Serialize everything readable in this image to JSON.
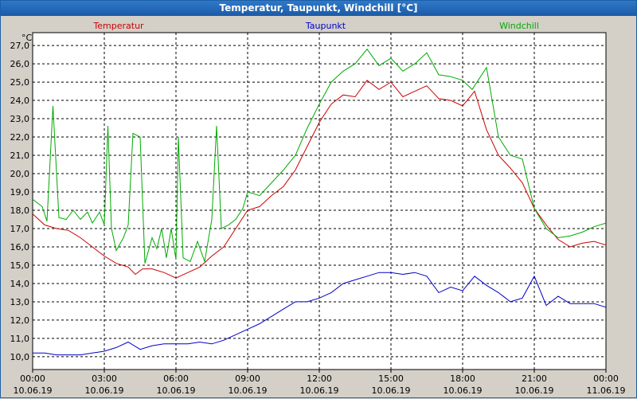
{
  "window": {
    "title": "Temperatur, Taupunkt, Windchill [°C]"
  },
  "chart_data": {
    "type": "line",
    "title": "Temperatur, Taupunkt, Windchill [°C]",
    "ylabel": "°C",
    "ylim": [
      9.3,
      27.7
    ],
    "yticks": [
      "10,0",
      "11,0",
      "12,0",
      "13,0",
      "14,0",
      "15,0",
      "16,0",
      "17,0",
      "18,0",
      "19,0",
      "20,0",
      "21,0",
      "22,0",
      "23,0",
      "24,0",
      "25,0",
      "26,0",
      "27,0"
    ],
    "xlim": [
      0,
      24
    ],
    "xticks": [
      {
        "time": "00:00",
        "date": "10.06.19"
      },
      {
        "time": "03:00",
        "date": "10.06.19"
      },
      {
        "time": "06:00",
        "date": "10.06.19"
      },
      {
        "time": "09:00",
        "date": "10.06.19"
      },
      {
        "time": "12:00",
        "date": "10.06.19"
      },
      {
        "time": "15:00",
        "date": "10.06.19"
      },
      {
        "time": "18:00",
        "date": "10.06.19"
      },
      {
        "time": "21:00",
        "date": "10.06.19"
      },
      {
        "time": "00:00",
        "date": "11.06.19"
      }
    ],
    "grid": true,
    "legend_position": "top",
    "series": [
      {
        "name": "Temperatur",
        "color": "#cc0000",
        "points": [
          [
            0,
            17.8
          ],
          [
            0.5,
            17.2
          ],
          [
            1,
            17.0
          ],
          [
            1.5,
            16.9
          ],
          [
            2,
            16.5
          ],
          [
            2.5,
            16.0
          ],
          [
            3,
            15.5
          ],
          [
            3.5,
            15.1
          ],
          [
            4,
            14.9
          ],
          [
            4.3,
            14.5
          ],
          [
            4.6,
            14.8
          ],
          [
            5,
            14.8
          ],
          [
            5.5,
            14.6
          ],
          [
            6,
            14.3
          ],
          [
            6.5,
            14.6
          ],
          [
            7,
            14.9
          ],
          [
            7.5,
            15.5
          ],
          [
            8,
            16.0
          ],
          [
            8.5,
            17.0
          ],
          [
            9,
            18.0
          ],
          [
            9.5,
            18.2
          ],
          [
            10,
            18.8
          ],
          [
            10.5,
            19.3
          ],
          [
            11,
            20.2
          ],
          [
            11.5,
            21.5
          ],
          [
            12,
            22.8
          ],
          [
            12.5,
            23.8
          ],
          [
            13,
            24.3
          ],
          [
            13.5,
            24.2
          ],
          [
            14,
            25.1
          ],
          [
            14.5,
            24.6
          ],
          [
            15,
            25.0
          ],
          [
            15.5,
            24.2
          ],
          [
            16,
            24.5
          ],
          [
            16.5,
            24.8
          ],
          [
            17,
            24.1
          ],
          [
            17.5,
            24.0
          ],
          [
            18,
            23.7
          ],
          [
            18.5,
            24.5
          ],
          [
            19,
            22.4
          ],
          [
            19.5,
            21.0
          ],
          [
            20,
            20.3
          ],
          [
            20.5,
            19.5
          ],
          [
            21,
            18.1
          ],
          [
            21.5,
            17.2
          ],
          [
            22,
            16.4
          ],
          [
            22.5,
            16.0
          ],
          [
            23,
            16.2
          ],
          [
            23.5,
            16.3
          ],
          [
            24,
            16.1
          ]
        ]
      },
      {
        "name": "Taupunkt",
        "color": "#0000cc",
        "points": [
          [
            0,
            10.2
          ],
          [
            0.5,
            10.2
          ],
          [
            1,
            10.1
          ],
          [
            1.5,
            10.1
          ],
          [
            2,
            10.1
          ],
          [
            2.5,
            10.2
          ],
          [
            3,
            10.3
          ],
          [
            3.5,
            10.5
          ],
          [
            4,
            10.8
          ],
          [
            4.5,
            10.4
          ],
          [
            5,
            10.6
          ],
          [
            5.5,
            10.7
          ],
          [
            6,
            10.7
          ],
          [
            6.5,
            10.7
          ],
          [
            7,
            10.8
          ],
          [
            7.5,
            10.7
          ],
          [
            8,
            10.9
          ],
          [
            8.5,
            11.2
          ],
          [
            9,
            11.5
          ],
          [
            9.5,
            11.8
          ],
          [
            10,
            12.2
          ],
          [
            10.5,
            12.6
          ],
          [
            11,
            13.0
          ],
          [
            11.5,
            13.0
          ],
          [
            12,
            13.2
          ],
          [
            12.5,
            13.5
          ],
          [
            13,
            14.0
          ],
          [
            13.5,
            14.2
          ],
          [
            14,
            14.4
          ],
          [
            14.5,
            14.6
          ],
          [
            15,
            14.6
          ],
          [
            15.5,
            14.5
          ],
          [
            16,
            14.6
          ],
          [
            16.5,
            14.4
          ],
          [
            17,
            13.5
          ],
          [
            17.5,
            13.8
          ],
          [
            18,
            13.6
          ],
          [
            18.5,
            14.4
          ],
          [
            19,
            13.9
          ],
          [
            19.5,
            13.5
          ],
          [
            20,
            13.0
          ],
          [
            20.5,
            13.2
          ],
          [
            21,
            14.4
          ],
          [
            21.5,
            12.8
          ],
          [
            22,
            13.3
          ],
          [
            22.5,
            12.9
          ],
          [
            23,
            12.9
          ],
          [
            23.5,
            12.9
          ],
          [
            24,
            12.7
          ]
        ]
      },
      {
        "name": "Windchill",
        "color": "#00aa00",
        "points": [
          [
            0,
            18.6
          ],
          [
            0.4,
            18.2
          ],
          [
            0.6,
            17.4
          ],
          [
            0.85,
            23.7
          ],
          [
            1.1,
            17.6
          ],
          [
            1.4,
            17.5
          ],
          [
            1.7,
            18.0
          ],
          [
            2,
            17.5
          ],
          [
            2.3,
            17.9
          ],
          [
            2.5,
            17.3
          ],
          [
            2.8,
            17.9
          ],
          [
            3,
            17.2
          ],
          [
            3.15,
            22.6
          ],
          [
            3.3,
            17.0
          ],
          [
            3.5,
            15.8
          ],
          [
            3.8,
            16.5
          ],
          [
            4,
            17.2
          ],
          [
            4.2,
            22.2
          ],
          [
            4.5,
            22.0
          ],
          [
            4.7,
            15.1
          ],
          [
            5,
            16.5
          ],
          [
            5.2,
            15.9
          ],
          [
            5.4,
            17.0
          ],
          [
            5.6,
            15.4
          ],
          [
            5.8,
            17.0
          ],
          [
            6.0,
            15.3
          ],
          [
            6.1,
            22.0
          ],
          [
            6.3,
            15.4
          ],
          [
            6.6,
            15.2
          ],
          [
            6.9,
            16.3
          ],
          [
            7.2,
            15.2
          ],
          [
            7.5,
            17.5
          ],
          [
            7.7,
            22.6
          ],
          [
            7.9,
            17.0
          ],
          [
            8.2,
            17.2
          ],
          [
            8.5,
            17.5
          ],
          [
            8.8,
            18.1
          ],
          [
            9,
            19.0
          ],
          [
            9.5,
            18.8
          ],
          [
            10,
            19.5
          ],
          [
            10.5,
            20.2
          ],
          [
            11,
            21.0
          ],
          [
            11.5,
            22.5
          ],
          [
            12,
            23.8
          ],
          [
            12.5,
            25.0
          ],
          [
            13,
            25.6
          ],
          [
            13.5,
            26.0
          ],
          [
            14,
            26.8
          ],
          [
            14.5,
            25.9
          ],
          [
            15,
            26.3
          ],
          [
            15.5,
            25.6
          ],
          [
            16,
            26.0
          ],
          [
            16.5,
            26.6
          ],
          [
            17,
            25.4
          ],
          [
            17.5,
            25.3
          ],
          [
            18,
            25.1
          ],
          [
            18.4,
            24.6
          ],
          [
            19,
            25.8
          ],
          [
            19.5,
            22.0
          ],
          [
            20,
            21.0
          ],
          [
            20.5,
            20.8
          ],
          [
            21,
            18.1
          ],
          [
            21.5,
            17.0
          ],
          [
            22,
            16.5
          ],
          [
            22.5,
            16.6
          ],
          [
            23,
            16.8
          ],
          [
            23.5,
            17.1
          ],
          [
            24,
            17.3
          ]
        ]
      }
    ]
  }
}
